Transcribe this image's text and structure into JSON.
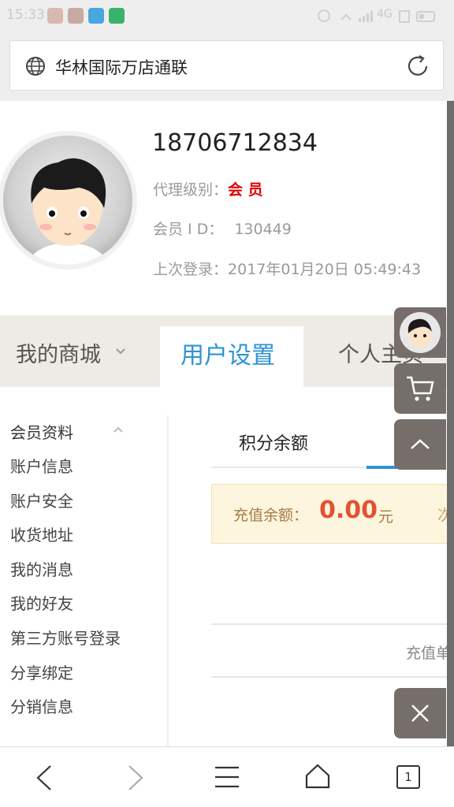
{
  "status_bar": {
    "time": "15:33",
    "network": "4G"
  },
  "address_bar": {
    "title": "华林国际万店通联"
  },
  "profile": {
    "phone": "18706712834",
    "level_label": "代理级别：",
    "level_value": "会 员",
    "member_id_label": "会员 I D：",
    "member_id_value": "130449",
    "last_login_label": "上次登录：",
    "last_login_value": "2017年01月20日 05:49:43"
  },
  "tabs": {
    "mall": "我的商城",
    "user_settings": "用户设置",
    "home": "个人主页"
  },
  "menu": {
    "items": [
      "会员资料",
      "账户信息",
      "账户安全",
      "收货地址",
      "我的消息",
      "我的好友",
      "第三方账号登录",
      "分享绑定",
      "分销信息"
    ]
  },
  "content": {
    "points_tab": "积分余额",
    "balance_label": "充值余额：",
    "balance_value": "0.00",
    "balance_unit": "元",
    "balance_cut": "次",
    "recharge_cut": "充值单"
  },
  "bottom_nav": {
    "tab_count": "1"
  },
  "colors": {
    "accent_blue": "#2e93d6",
    "member_red": "#e30000",
    "balance_red": "#e25232",
    "float_button": "#756e6b"
  }
}
